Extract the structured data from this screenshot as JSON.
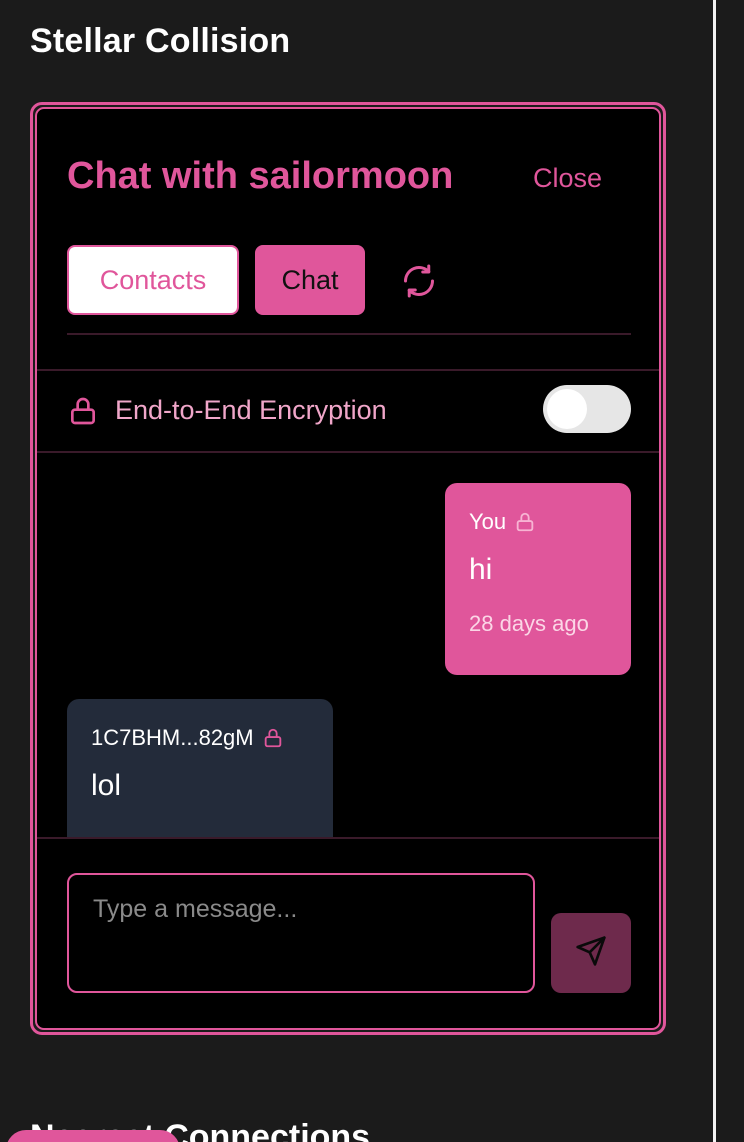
{
  "page": {
    "title": "Stellar Collision",
    "bottom_heading": "Nearest Connections"
  },
  "chat": {
    "title": "Chat with sailormoon",
    "close_label": "Close",
    "tabs": [
      {
        "label": "Contacts",
        "active": false
      },
      {
        "label": "Chat",
        "active": true
      }
    ],
    "refresh_icon": "refresh-icon",
    "encryption": {
      "label": "End-to-End Encryption",
      "enabled": false,
      "icon": "lock-icon"
    },
    "messages": [
      {
        "sender": "You",
        "text": "hi",
        "time": "28 days ago",
        "direction": "outgoing",
        "encrypted": true
      },
      {
        "sender": "1C7BHM...82gM",
        "text": "lol",
        "direction": "incoming",
        "encrypted": true
      }
    ],
    "composer": {
      "placeholder": "Type a message...",
      "value": "",
      "send_icon": "send-icon"
    }
  },
  "colors": {
    "accent": "#e0569b",
    "background": "#000000",
    "page_background": "#1b1b1b",
    "incoming_bubble": "#232b3a",
    "send_button": "#6e2a4c"
  }
}
